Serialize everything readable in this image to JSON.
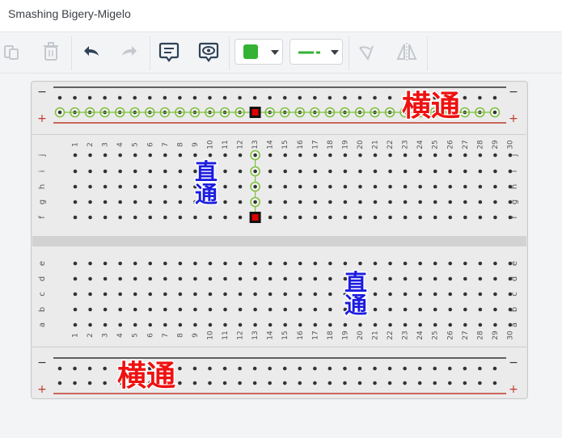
{
  "window": {
    "title": "Smashing Bigery-Migelo"
  },
  "toolbar": {
    "copy_icon": "copy-icon",
    "delete_icon": "trash-icon",
    "undo_icon": "undo-icon",
    "redo_icon": "redo-icon",
    "note_icon": "note-icon",
    "view_icon": "eye-bubble-icon",
    "fill_color": "#33b233",
    "wire_color": "#33b233",
    "rotate_icon": "rotate-icon",
    "flip_icon": "flip-icon"
  },
  "breadboard": {
    "columns": [
      1,
      2,
      3,
      4,
      5,
      6,
      7,
      8,
      9,
      10,
      11,
      12,
      13,
      14,
      15,
      16,
      17,
      18,
      19,
      20,
      21,
      22,
      23,
      24,
      25,
      26,
      27,
      28,
      29,
      30
    ],
    "rows_top": [
      "j",
      "i",
      "h",
      "g",
      "f"
    ],
    "rows_bottom": [
      "e",
      "d",
      "c",
      "b",
      "a"
    ],
    "rail_minus": "−",
    "rail_plus": "+",
    "highlight_color": "#7fbf3f",
    "selected_marker_color": "#e00000"
  },
  "annotations": {
    "top_rail": "横通",
    "bottom_rail": "横通",
    "column_top": "直通",
    "column_bottom": "直通"
  }
}
